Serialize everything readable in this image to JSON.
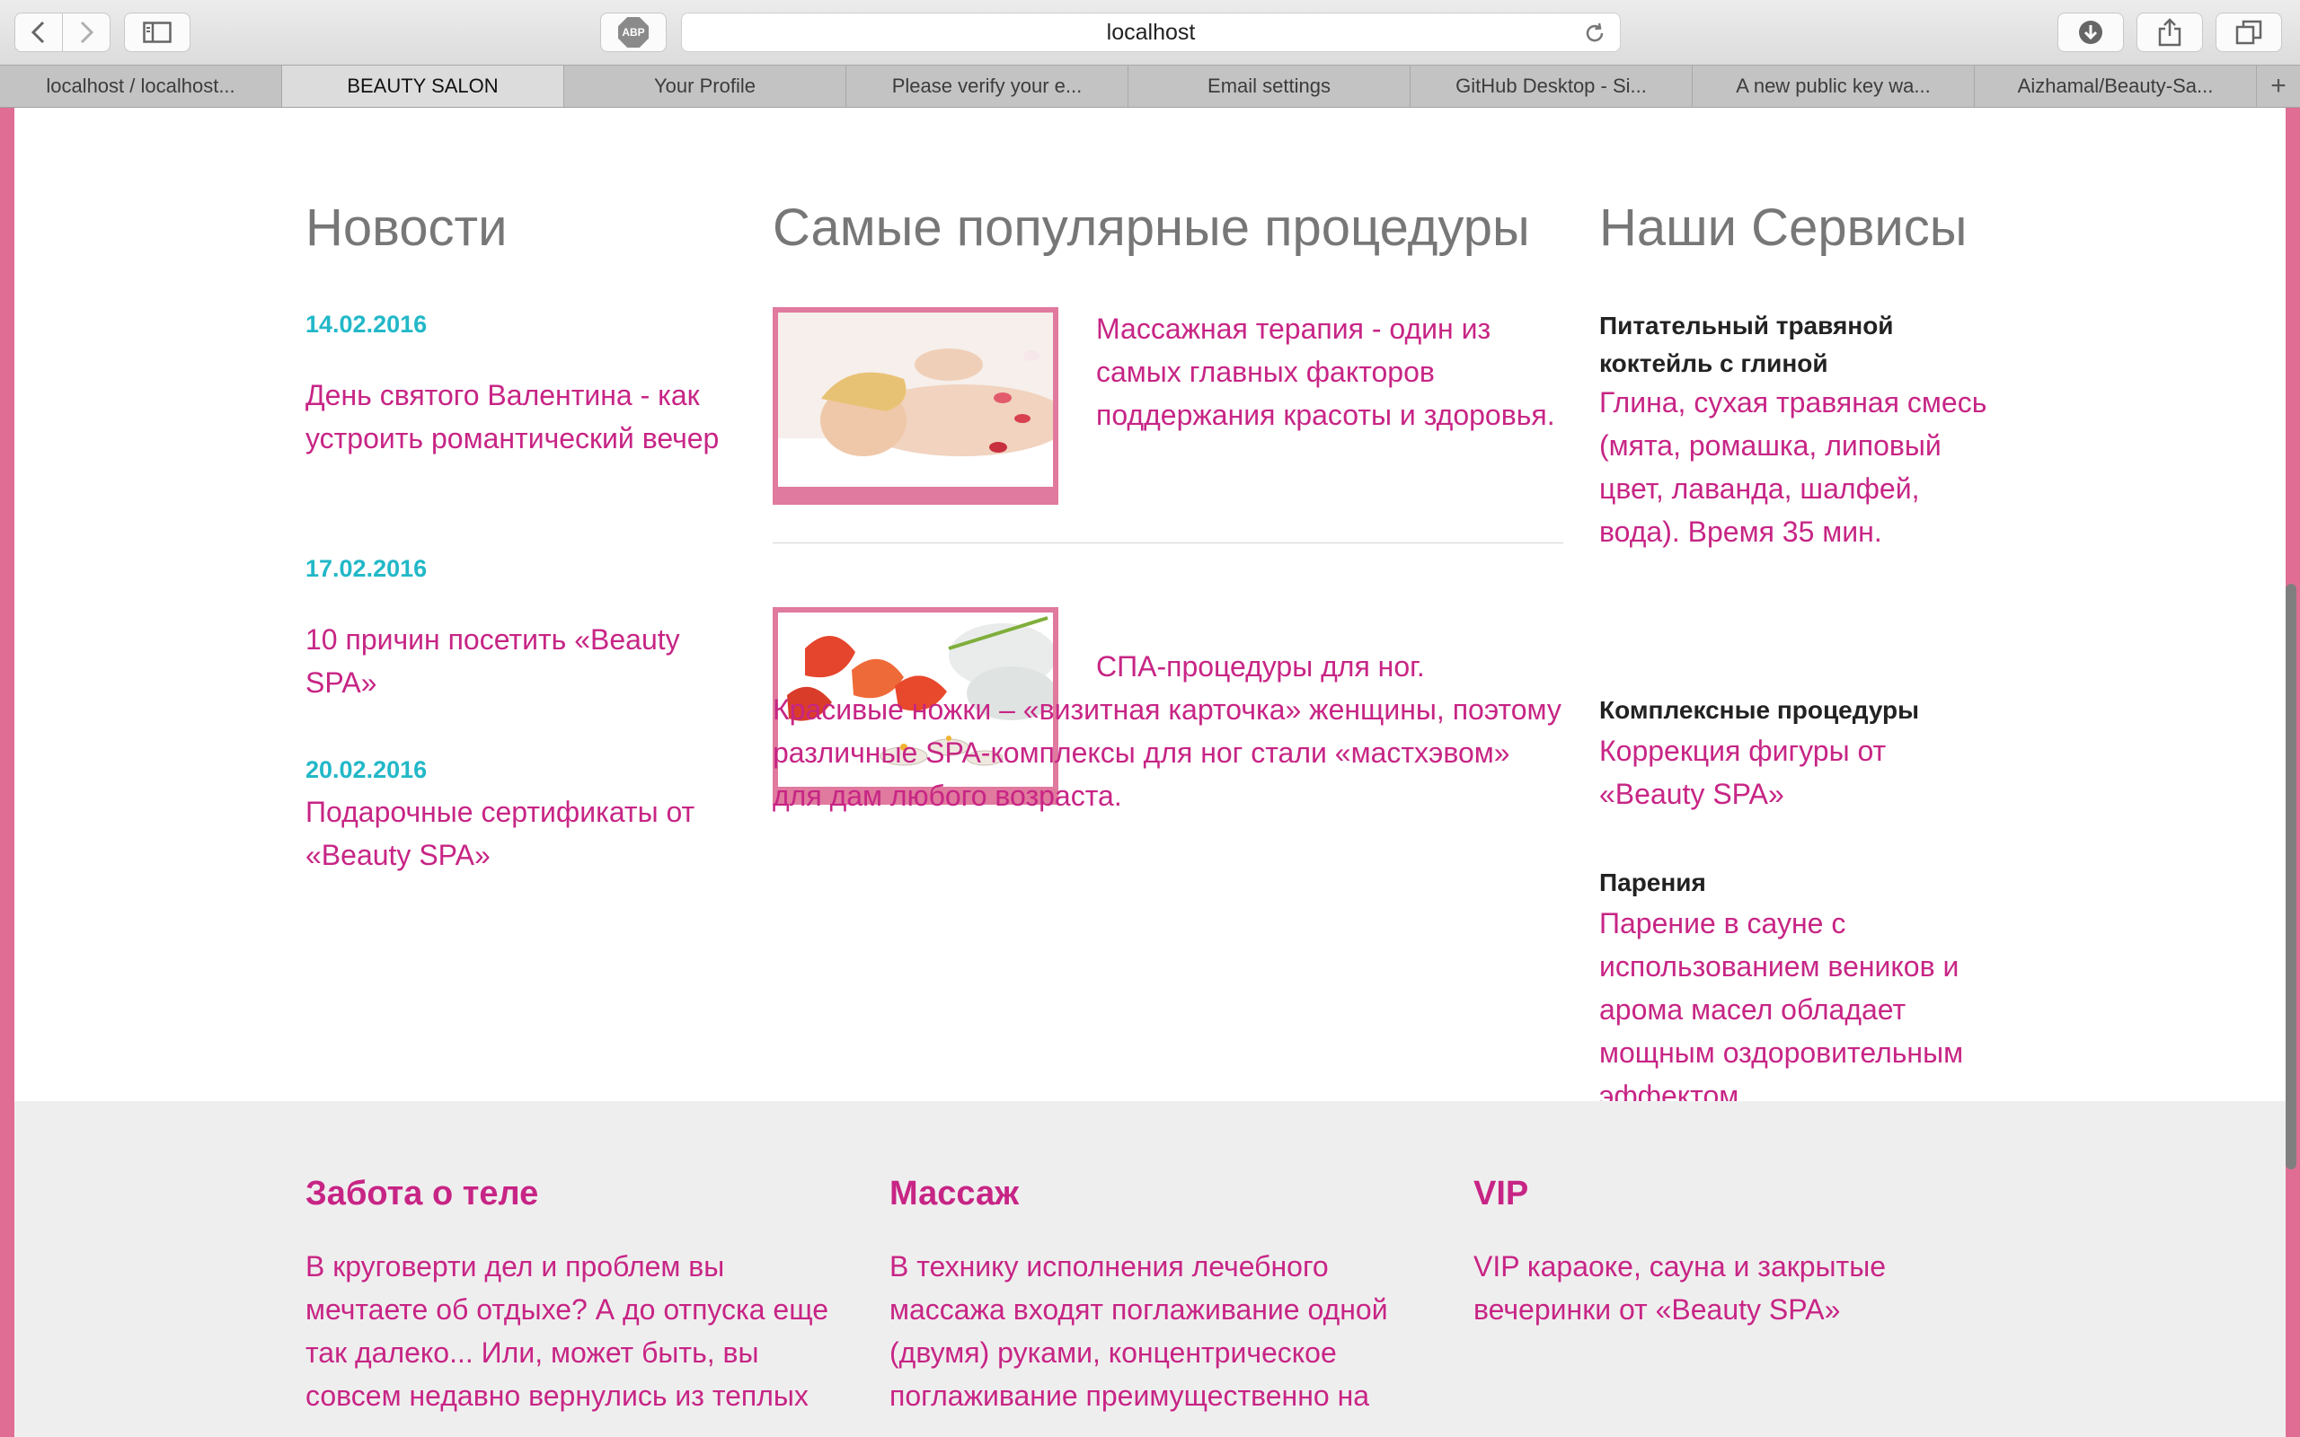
{
  "browser": {
    "url": "localhost",
    "abp_label": "ABP",
    "tabs": [
      {
        "label": "localhost / localhost..."
      },
      {
        "label": "BEAUTY SALON"
      },
      {
        "label": "Your Profile"
      },
      {
        "label": "Please verify your e..."
      },
      {
        "label": "Email settings"
      },
      {
        "label": "GitHub Desktop - Si..."
      },
      {
        "label": "A new public key wa..."
      },
      {
        "label": "Aizhamal/Beauty-Sa..."
      }
    ],
    "new_tab_label": "+"
  },
  "news": {
    "title": "Новости",
    "items": [
      {
        "date": "14.02.2016",
        "text": "День святого Валентина - как устроить романтический вечер"
      },
      {
        "date": "17.02.2016",
        "text": "10 причин посетить «Beauty SPA»"
      },
      {
        "date": "20.02.2016",
        "text": "Подарочные сертификаты от «Beauty SPA»"
      }
    ]
  },
  "procedures": {
    "title": "Самые популярные процедуры",
    "items": [
      {
        "text": "Массажная терапия - один из самых главных факторов поддержания красоты и здоровья."
      },
      {
        "text": "СПА-процедуры для ног. Красивые ножки – «визитная карточка» женщины, поэтому различные SPA-комплексы для ног стали «мастхэвом» для дам любого возраста."
      }
    ]
  },
  "services": {
    "title": "Наши Сервисы",
    "items": [
      {
        "name": "Питательный травяной коктейль с глиной",
        "text": "Глина, сухая травяная смесь (мята, ромашка, липовый цвет, лаванда, шалфей, вода). Время 35 мин."
      },
      {
        "name": "Комплексные процедуры",
        "text": "Коррекция фигуры от «Beauty SPA»"
      },
      {
        "name": "Парения",
        "text": "Парение в сауне с использованием веников и арома масел обладает мощным оздоровительным эффектом."
      }
    ]
  },
  "footer": {
    "columns": [
      {
        "title": "Забота о теле",
        "text": "В круговерти дел и проблем вы мечтаете об отдыхе? А до отпуска еще так далеко... Или, может быть, вы совсем недавно вернулись из теплых"
      },
      {
        "title": "Массаж",
        "text": "В технику исполнения лечебного массажа входят поглаживание одной (двумя) руками, концентрическое поглаживание преимущественно на"
      },
      {
        "title": "VIP",
        "text": "VIP караоке, сауна и закрытые вечеринки от «Beauty SPA»"
      }
    ]
  },
  "colors": {
    "accent": "#c72585",
    "date": "#22b8c8",
    "frame": "#e06e94",
    "heading": "#777777"
  }
}
